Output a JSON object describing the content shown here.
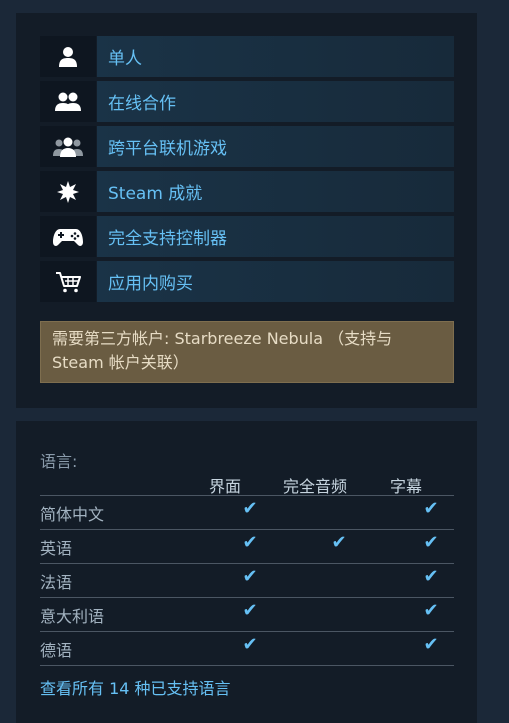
{
  "features": [
    {
      "icon": "single-player-icon",
      "label": "单人"
    },
    {
      "icon": "online-coop-icon",
      "label": "在线合作"
    },
    {
      "icon": "cross-platform-icon",
      "label": "跨平台联机游戏"
    },
    {
      "icon": "achievements-icon",
      "label": "Steam 成就"
    },
    {
      "icon": "controller-icon",
      "label": "完全支持控制器"
    },
    {
      "icon": "cart-icon",
      "label": "应用内购买"
    }
  ],
  "notice": {
    "text": "需要第三方帐户: Starbreeze Nebula （支持与 Steam 帐户关联）"
  },
  "languages": {
    "title": "语言:",
    "columns": [
      "界面",
      "完全音频",
      "字幕"
    ],
    "check_symbol": "✔",
    "rows": [
      {
        "name": "简体中文",
        "interface": true,
        "audio": false,
        "subtitles": true
      },
      {
        "name": "英语",
        "interface": true,
        "audio": true,
        "subtitles": true
      },
      {
        "name": "法语",
        "interface": true,
        "audio": false,
        "subtitles": true
      },
      {
        "name": "意大利语",
        "interface": true,
        "audio": false,
        "subtitles": true
      },
      {
        "name": "德语",
        "interface": true,
        "audio": false,
        "subtitles": true
      }
    ],
    "all_link": "查看所有 14 种已支持语言"
  },
  "colors": {
    "page_bg": "#1b2838",
    "panel_bg": "#131c27",
    "link": "#66c0f4",
    "notice_bg": "#6a5c42"
  }
}
